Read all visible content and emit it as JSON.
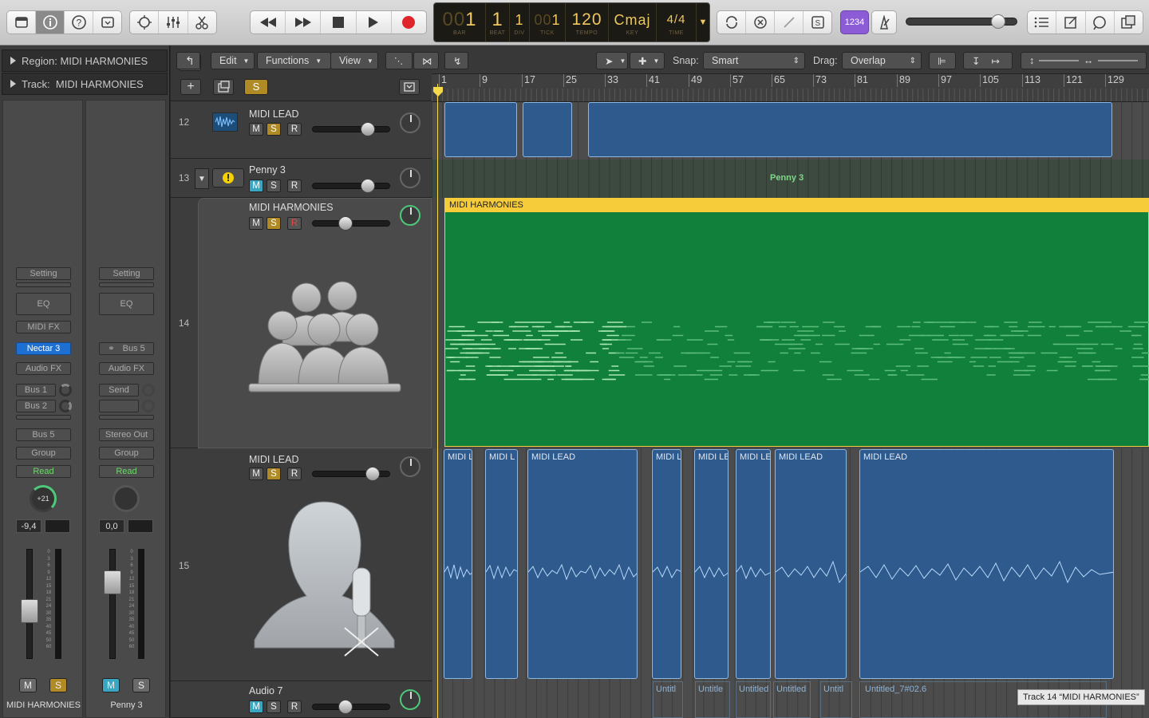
{
  "toolbar": {
    "left_icons": [
      "library-icon",
      "info-icon",
      "help-icon",
      "toolbar-icon"
    ],
    "edit_icons": [
      "smart-controls-icon",
      "mixer-icon",
      "scissors-icon"
    ],
    "transport": [
      "rewind-icon",
      "fast-forward-icon",
      "stop-icon",
      "play-icon",
      "record-icon"
    ],
    "lcd": {
      "bar": "1",
      "bar_prefix": "00",
      "bar_label": "BAR",
      "beat": "1",
      "beat_label": "BEAT",
      "div": "1",
      "div_label": "DIV",
      "tick": "1",
      "tick_prefix": "00",
      "tick_label": "TICK",
      "tempo": "120",
      "tempo_label": "TEMPO",
      "key": "Cmaj",
      "key_label": "KEY",
      "time_sig": "4/4",
      "time_label": "TIME"
    },
    "mode_icons": [
      "cycle-icon",
      "replace-icon",
      "tuning-icon",
      "solo-icon"
    ],
    "count_in_label": "1234",
    "metronome": "metronome-icon",
    "master_volume": 0.83,
    "right_icons": [
      "list-editor-icon",
      "note-pad-icon",
      "loop-browser-icon",
      "browser-icon"
    ]
  },
  "inspector": {
    "region_label": "Region:",
    "region_name": "MIDI HARMONIES",
    "track_label": "Track:",
    "track_name": "MIDI HARMONIES",
    "strip1": {
      "setting": "Setting",
      "eq": "EQ",
      "midi_fx": "MIDI FX",
      "instrument": "Nectar 3",
      "audio_fx": "Audio FX",
      "send1": "Bus 1",
      "send2": "Bus 2",
      "output": "Bus 5",
      "group": "Group",
      "automation": "Read",
      "pan_value": "+21",
      "gain": "-9,4",
      "mute": "M",
      "solo": "S",
      "name": "MIDI HARMONIES"
    },
    "strip2": {
      "setting": "Setting",
      "eq": "EQ",
      "input": "Bus 5",
      "audio_fx": "Audio FX",
      "send": "Send",
      "output": "Stereo Out",
      "group": "Group",
      "automation": "Read",
      "gain": "0,0",
      "mute": "M",
      "solo": "S",
      "name": "Penny 3"
    },
    "scale": [
      "0",
      "3",
      "6",
      "9",
      "12",
      "15",
      "18",
      "21",
      "24",
      "30",
      "35",
      "40",
      "45",
      "50",
      "60"
    ]
  },
  "track_tools": {
    "add_label": "+",
    "solo_label": "S"
  },
  "tracks": [
    {
      "number": "12",
      "name": "MIDI LEAD",
      "mute": "M",
      "solo": "S",
      "rec": "R",
      "volume": 0.72
    },
    {
      "number": "13",
      "name": "Penny 3",
      "mute": "M",
      "solo": "S",
      "rec": "R",
      "volume": 0.72
    },
    {
      "number": "14",
      "name": "MIDI HARMONIES",
      "mute": "M",
      "solo": "S",
      "rec": "R",
      "volume": 0.43
    },
    {
      "number": "15",
      "name": "MIDI LEAD",
      "mute": "M",
      "solo": "S",
      "rec": "R",
      "volume": 0.78
    },
    {
      "number": "",
      "name": "Audio 7",
      "mute": "M",
      "solo": "S",
      "rec": "R",
      "volume": 0.43
    }
  ],
  "arrange_menu": {
    "edit": "Edit",
    "functions": "Functions",
    "view": "View",
    "snap_label": "Snap:",
    "snap_value": "Smart",
    "drag_label": "Drag:",
    "drag_value": "Overlap"
  },
  "ruler": [
    "1",
    "9",
    "17",
    "25",
    "33",
    "41",
    "49",
    "57",
    "65",
    "73",
    "81",
    "89",
    "97",
    "105",
    "113",
    "121",
    "129"
  ],
  "regions": {
    "penny3_label": "Penny 3",
    "harmonies_label": "MIDI HARMONIES",
    "lead_labels": [
      "MIDI L",
      "MIDI L",
      "MIDI LEAD",
      "MIDI L",
      "MIDI LE",
      "MIDI LE",
      "MIDI LEAD",
      "MIDI LEAD"
    ],
    "audio7_labels": [
      "Untitl",
      "Untitle",
      "Untitled",
      "Untitled",
      "Untitl",
      "Untitled_7#02.6"
    ]
  },
  "tooltip": "Track 14 “MIDI HARMONIES”",
  "colors": {
    "midi_green": "#11803a",
    "region_yellow": "#f6cc3a",
    "audio_blue": "#2e5a8e",
    "count_in_purple": "#8b5cd6"
  }
}
